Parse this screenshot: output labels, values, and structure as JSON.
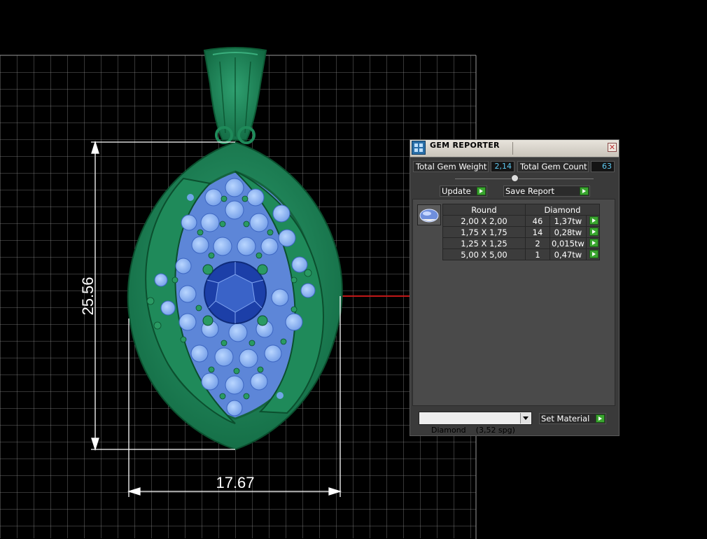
{
  "dimensions": {
    "height_label": "25.56",
    "width_label": "17.67"
  },
  "gem_reporter": {
    "title": "GEM REPORTER",
    "close_glyph": "✕",
    "total_gem_weight_label": "Total Gem Weight",
    "total_gem_weight_value": "2,14",
    "total_gem_count_label": "Total Gem Count",
    "total_gem_count_value": "63",
    "update_label": "Update",
    "save_report_label": "Save Report",
    "table": {
      "columns": [
        "Round",
        "Diamond"
      ],
      "rows": [
        {
          "size": "2,00 X 2,00",
          "count": "46",
          "weight": "1,37tw"
        },
        {
          "size": "1,75 X 1,75",
          "count": "14",
          "weight": "0,28tw"
        },
        {
          "size": "1,25 X 1,25",
          "count": "2",
          "weight": "0,015tw"
        },
        {
          "size": "5,00 X 5,00",
          "count": "1",
          "weight": "0,47tw"
        }
      ]
    },
    "material_value": "Diamond    (3,52 spg)",
    "set_material_label": "Set Material"
  },
  "colors": {
    "metal": "#1f8a5a",
    "gem_light": "#7fb0f0",
    "gem_dark": "#1c3fa8",
    "accent_value": "#5ec8f0",
    "go_button": "#3aa52f"
  }
}
